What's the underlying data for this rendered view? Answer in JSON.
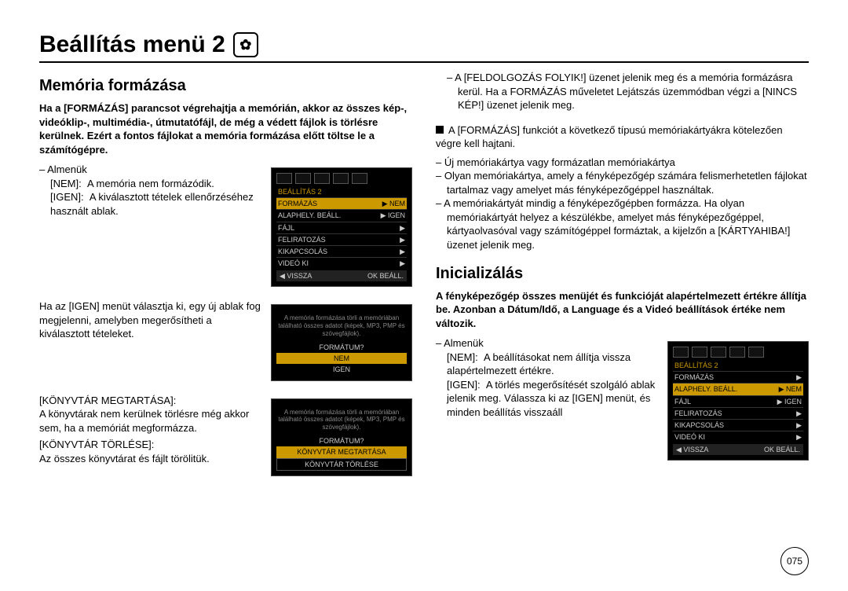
{
  "page": {
    "title": "Beállítás menü 2",
    "number": "075"
  },
  "left": {
    "h_memformat": "Memória formázása",
    "intro": "Ha a [FORMÁZÁS] parancsot végrehajtja a memórián, akkor az összes kép-, videóklip-, multimédia-, útmutatófájl, de még a védett fájlok is törlésre kerülnek. Ezért a fontos fájlokat a memória formázása előtt töltse le a számítógépre.",
    "submenu_label": "Almenük",
    "nem_label": "[NEM]:",
    "nem_text": "A memória nem formázódik.",
    "igen_label": "[IGEN]:",
    "igen_text": "A kiválasztott tételek ellenőrzéséhez használt ablak.",
    "igen_block": "Ha az [IGEN] menüt választja ki, egy új ablak fog megjelenni, amelyben megerősítheti a kiválasztott tételeket.",
    "konyvtar_keep_label": "[KÖNYVTÁR MEGTARTÁSA]:",
    "konyvtar_keep_text": "A könyvtárak nem kerülnek törlésre még akkor sem, ha a memóriát megformázza.",
    "konyvtar_del_label": "[KÖNYVTÁR TÖRLÉSE]:",
    "konyvtar_del_text": "Az összes könyvtárat és fájlt törölitük."
  },
  "right": {
    "processing": "A [FELDOLGOZÁS FOLYIK!] üzenet jelenik meg és a memória formázásra kerül. Ha a FORMÁZÁS műveletet Lejátszás üzemmódban végzi a [NINCS KÉP!] üzenet jelenik meg.",
    "must_format": "A [FORMÁZÁS] funkciót a következő típusú memóriakártyákra kötelezően végre kell hajtani.",
    "b1": "Új memóriakártya vagy formázatlan memóriakártya",
    "b2": "Olyan memóriakártya, amely a fényképezőgép számára felismerhetetlen fájlokat tartalmaz vagy amelyet más fényképezőgéppel használtak.",
    "b3": "A memóriakártyát mindig a fényképezőgépben formázza. Ha olyan memóriakártyát helyez a készülékbe, amelyet más fényképezőgéppel, kártyaolvasóval vagy számítógéppel formáztak, a kijelzőn a [KÁRTYAHIBA!] üzenet jelenik meg.",
    "h_init": "Inicializálás",
    "init_intro": "A fényképezőgép összes menüjét és funkcióját alapértelmezett értékre állítja be. Azonban a Dátum/Idő, a Language és a Videó beállítások értéke nem változik.",
    "submenu_label": "Almenük",
    "nem_label": "[NEM]:",
    "nem_text": "A beállításokat nem állítja vissza alapértelmezett értékre.",
    "igen_label": "[IGEN]:",
    "igen_text": "A törlés megerősítését szolgáló ablak jelenik meg. Válassza ki az [IGEN] menüt, és minden beállítás visszaáll"
  },
  "shot1": {
    "title": "BEÁLLÍTÁS 2",
    "r1a": "FORMÁZÁS",
    "r1b": "NEM",
    "r2a": "ALAPHELY. BEÁLL.",
    "r2b": "IGEN",
    "r3a": "FÁJL",
    "r3b": "",
    "r4a": "FELIRATOZÁS",
    "r4b": "",
    "r5a": "KIKAPCSOLÁS",
    "r5b": "",
    "r6a": "VIDEÓ KI",
    "r6b": "",
    "fL": "◀  VISSZA",
    "fR": "OK  BEÁLL."
  },
  "shot2": {
    "msg": "A memória formázása törli a memóriában található összes adatot (képek, MP3, PMP és szövegfájlok).",
    "q": "FORMÁTUM?",
    "o1": "NEM",
    "o2": "IGEN"
  },
  "shot3": {
    "msg": "A memória formázása törli a memóriában található összes adatot (képek, MP3, PMP és szövegfájlok).",
    "q": "FORMÁTUM?",
    "o1": "KÖNYVTÁR MEGTARTÁSA",
    "o2": "KÖNYVTÁR TÖRLÉSE"
  },
  "shot4": {
    "title": "BEÁLLÍTÁS 2",
    "r1a": "FORMÁZÁS",
    "r1b": "",
    "r2a": "ALAPHELY. BEÁLL.",
    "r2b": "NEM",
    "r3a": "FÁJL",
    "r3b": "IGEN",
    "r4a": "FELIRATOZÁS",
    "r4b": "",
    "r5a": "KIKAPCSOLÁS",
    "r5b": "",
    "r6a": "VIDEÓ KI",
    "r6b": "",
    "fL": "◀  VISSZA",
    "fR": "OK  BEÁLL."
  }
}
